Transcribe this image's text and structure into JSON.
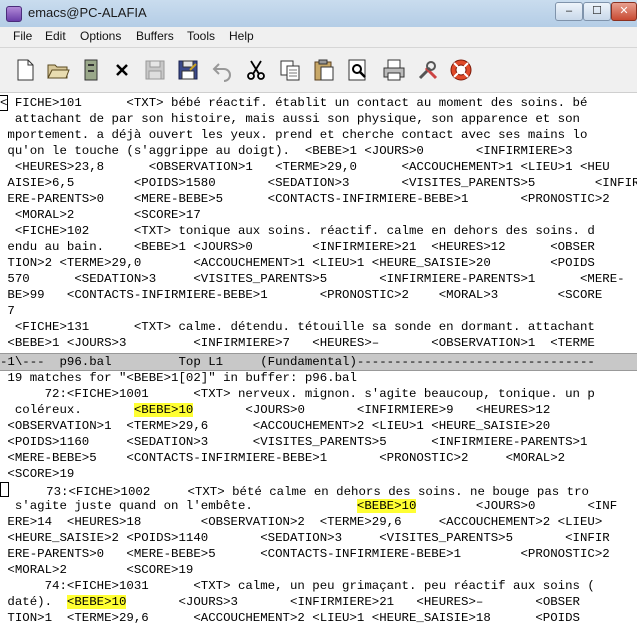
{
  "window": {
    "title": "emacs@PC-ALAFIA",
    "min_symbol": "–",
    "max_symbol": "☐",
    "close_symbol": "✕"
  },
  "menu": [
    "File",
    "Edit",
    "Options",
    "Buffers",
    "Tools",
    "Help"
  ],
  "toolbar_icons": [
    "new-file-icon",
    "open-folder-icon",
    "open-directory-icon",
    "close-icon",
    "save-icon-disabled",
    "save-as-icon",
    "undo-icon",
    "cut-icon",
    "copy-icon",
    "paste-icon",
    "search-icon",
    "print-icon",
    "preferences-icon",
    "help-icon"
  ],
  "top_pane": {
    "lines": [
      " FICHE>101      <TXT> bébé réactif. établit un contact au moment des soins. bé",
      "  attachant de par son histoire, mais aussi son physique, son apparence et son",
      " mportement. a déjà ouvert les yeux. prend et cherche contact avec ses mains lo",
      " qu'on le touche (s'aggrippe au doigt).  <BEBE>1 <JOURS>0       <INFIRMIERE>3",
      "  <HEURES>23,8      <OBSERVATION>1   <TERME>29,0      <ACCOUCHEMENT>1 <LIEU>1 <HEU",
      " AISIE>6,5        <POIDS>1580       <SEDATION>3       <VISITES_PARENTS>5        <INFIR",
      " ERE-PARENTS>0    <MERE-BEBE>5      <CONTACTS-INFIRMIERE-BEBE>1       <PRONOSTIC>2",
      "  <MORAL>2        <SCORE>17",
      "  <FICHE>102      <TXT> tonique aux soins. réactif. calme en dehors des soins. d",
      " endu au bain.    <BEBE>1 <JOURS>0        <INFIRMIERE>21  <HEURES>12      <OBSER",
      " TION>2 <TERME>29,0       <ACCOUCHEMENT>1 <LIEU>1 <HEURE_SAISIE>20        <POIDS",
      " 570      <SEDATION>3     <VISITES_PARENTS>5       <INFIRMIERE-PARENTS>1      <MERE-",
      " BE>99   <CONTACTS-INFIRMIERE-BEBE>1       <PRONOSTIC>2    <MORAL>3        <SCORE",
      " 7",
      "  <FICHE>131      <TXT> calme. détendu. tétouille sa sonde en dormant. attachant",
      " <BEBE>1 <JOURS>3         <INFIRMIERE>7   <HEURES>–       <OBSERVATION>1  <TERME"
    ],
    "first_char": "<"
  },
  "top_modeline": "-1\\---  p96.bal         Top L1     (Fundamental)--------------------------------",
  "bottom_pane": {
    "header": " 19 matches for \"<BEBE>1[02]\" in buffer: p96.bal",
    "lines": [
      {
        "text": "      72:<FICHE>1001      <TXT> nerveux. mignon. s'agite beaucoup, tonique. un p",
        "hl": ""
      },
      {
        "pre": "  coléreux.       ",
        "hl": "<BEBE>10",
        "post": "       <JOURS>0       <INFIRMIERE>9   <HEURES>12"
      },
      {
        "text": " <OBSERVATION>1  <TERME>29,6      <ACCOUCHEMENT>2 <LIEU>1 <HEURE_SAISIE>20",
        "hl": ""
      },
      {
        "text": " <POIDS>1160     <SEDATION>3      <VISITES_PARENTS>5      <INFIRMIERE-PARENTS>1",
        "hl": ""
      },
      {
        "text": " <MERE-BEBE>5    <CONTACTS-INFIRMIERE-BEBE>1       <PRONOSTIC>2     <MORAL>2",
        "hl": ""
      },
      {
        "text": " <SCORE>19",
        "hl": ""
      },
      {
        "cursor": true,
        "text": "     73:<FICHE>1002     <TXT> bété calme en dehors des soins. ne bouge pas tro"
      },
      {
        "pre": "  s'agite juste quand on l'embête.              ",
        "hl": "<BEBE>10",
        "post": "        <JOURS>0       <INF"
      },
      {
        "text": " ERE>14  <HEURES>18        <OBSERVATION>2  <TERME>29,6     <ACCOUCHEMENT>2 <LIEU>",
        "hl": ""
      },
      {
        "text": " <HEURE_SAISIE>2 <POIDS>1140       <SEDATION>3     <VISITES_PARENTS>5       <INFIR",
        "hl": ""
      },
      {
        "text": " ERE-PARENTS>0   <MERE-BEBE>5      <CONTACTS-INFIRMIERE-BEBE>1        <PRONOSTIC>2",
        "hl": ""
      },
      {
        "text": " <MORAL>2        <SCORE>19",
        "hl": ""
      },
      {
        "text": "      74:<FICHE>1031      <TXT> calme, un peu grimaçant. peu réactif aux soins (",
        "hl": ""
      },
      {
        "pre": " daté).  ",
        "hl": "<BEBE>10",
        "post": "       <JOURS>3       <INFIRMIERE>21   <HEURES>–       <OBSER"
      },
      {
        "text": " TION>1  <TERME>29,6      <ACCOUCHEMENT>2 <LIEU>1 <HEURE_SAISIE>18      <POIDS",
        "hl": ""
      }
    ]
  }
}
